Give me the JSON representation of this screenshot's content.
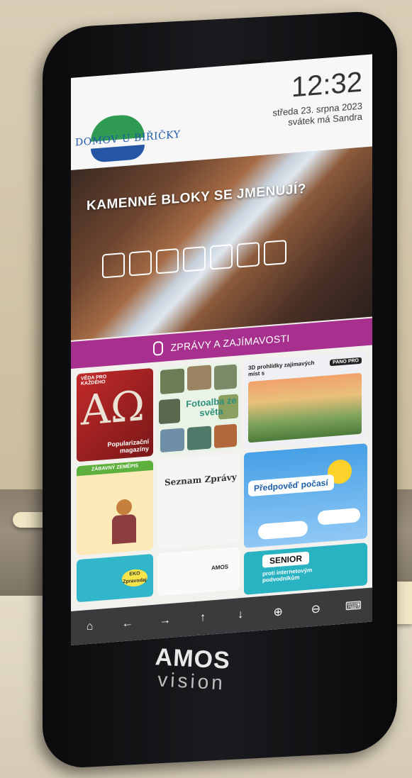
{
  "header": {
    "logo_text": "DOMOV U BIŘIČKY",
    "time": "12:32",
    "date": "středa 23. srpna 2023",
    "nameday": "svátek má Sandra"
  },
  "quiz": {
    "question": "KAMENNÉ BLOKY SE JMENUJÍ?",
    "answer_length": 7
  },
  "news": {
    "label": "ZPRÁVY A ZAJÍMAVOSTI",
    "mic_icon": "microphone-icon"
  },
  "tiles": {
    "popularizacni": "Popularizační magazíny",
    "popularizacni_top": "VĚDA PRO KAŽDÉHO",
    "fotoalba": "Fotoalba ze světa",
    "prohlidky": "3D prohlídky zajímavých míst s",
    "prohlidky_badge": "PANO PRO",
    "zemepis": "ZÁBAVNÝ ZEMĚPIS",
    "seznam": "Seznam Zprávy",
    "pocasi": "Předpověď počasí",
    "eko": "EKO Zpravodaj",
    "senior": "SENIOR",
    "senior_sub": "proti internetovým podvodníkům",
    "amos_small": "AMOS"
  },
  "nav": {
    "home": "⌂",
    "back": "←",
    "forward": "→",
    "up": "↑",
    "down": "↓",
    "zoom_in": "⊕",
    "zoom_out": "⊖",
    "keyboard": "⌨"
  },
  "brand": {
    "name": "AMOS",
    "sub": "vision"
  },
  "colors": {
    "news_bar": "#a7308e",
    "nav_bar": "#3b3b3e",
    "logo_green": "#2e9a52",
    "logo_blue": "#2456a5"
  }
}
